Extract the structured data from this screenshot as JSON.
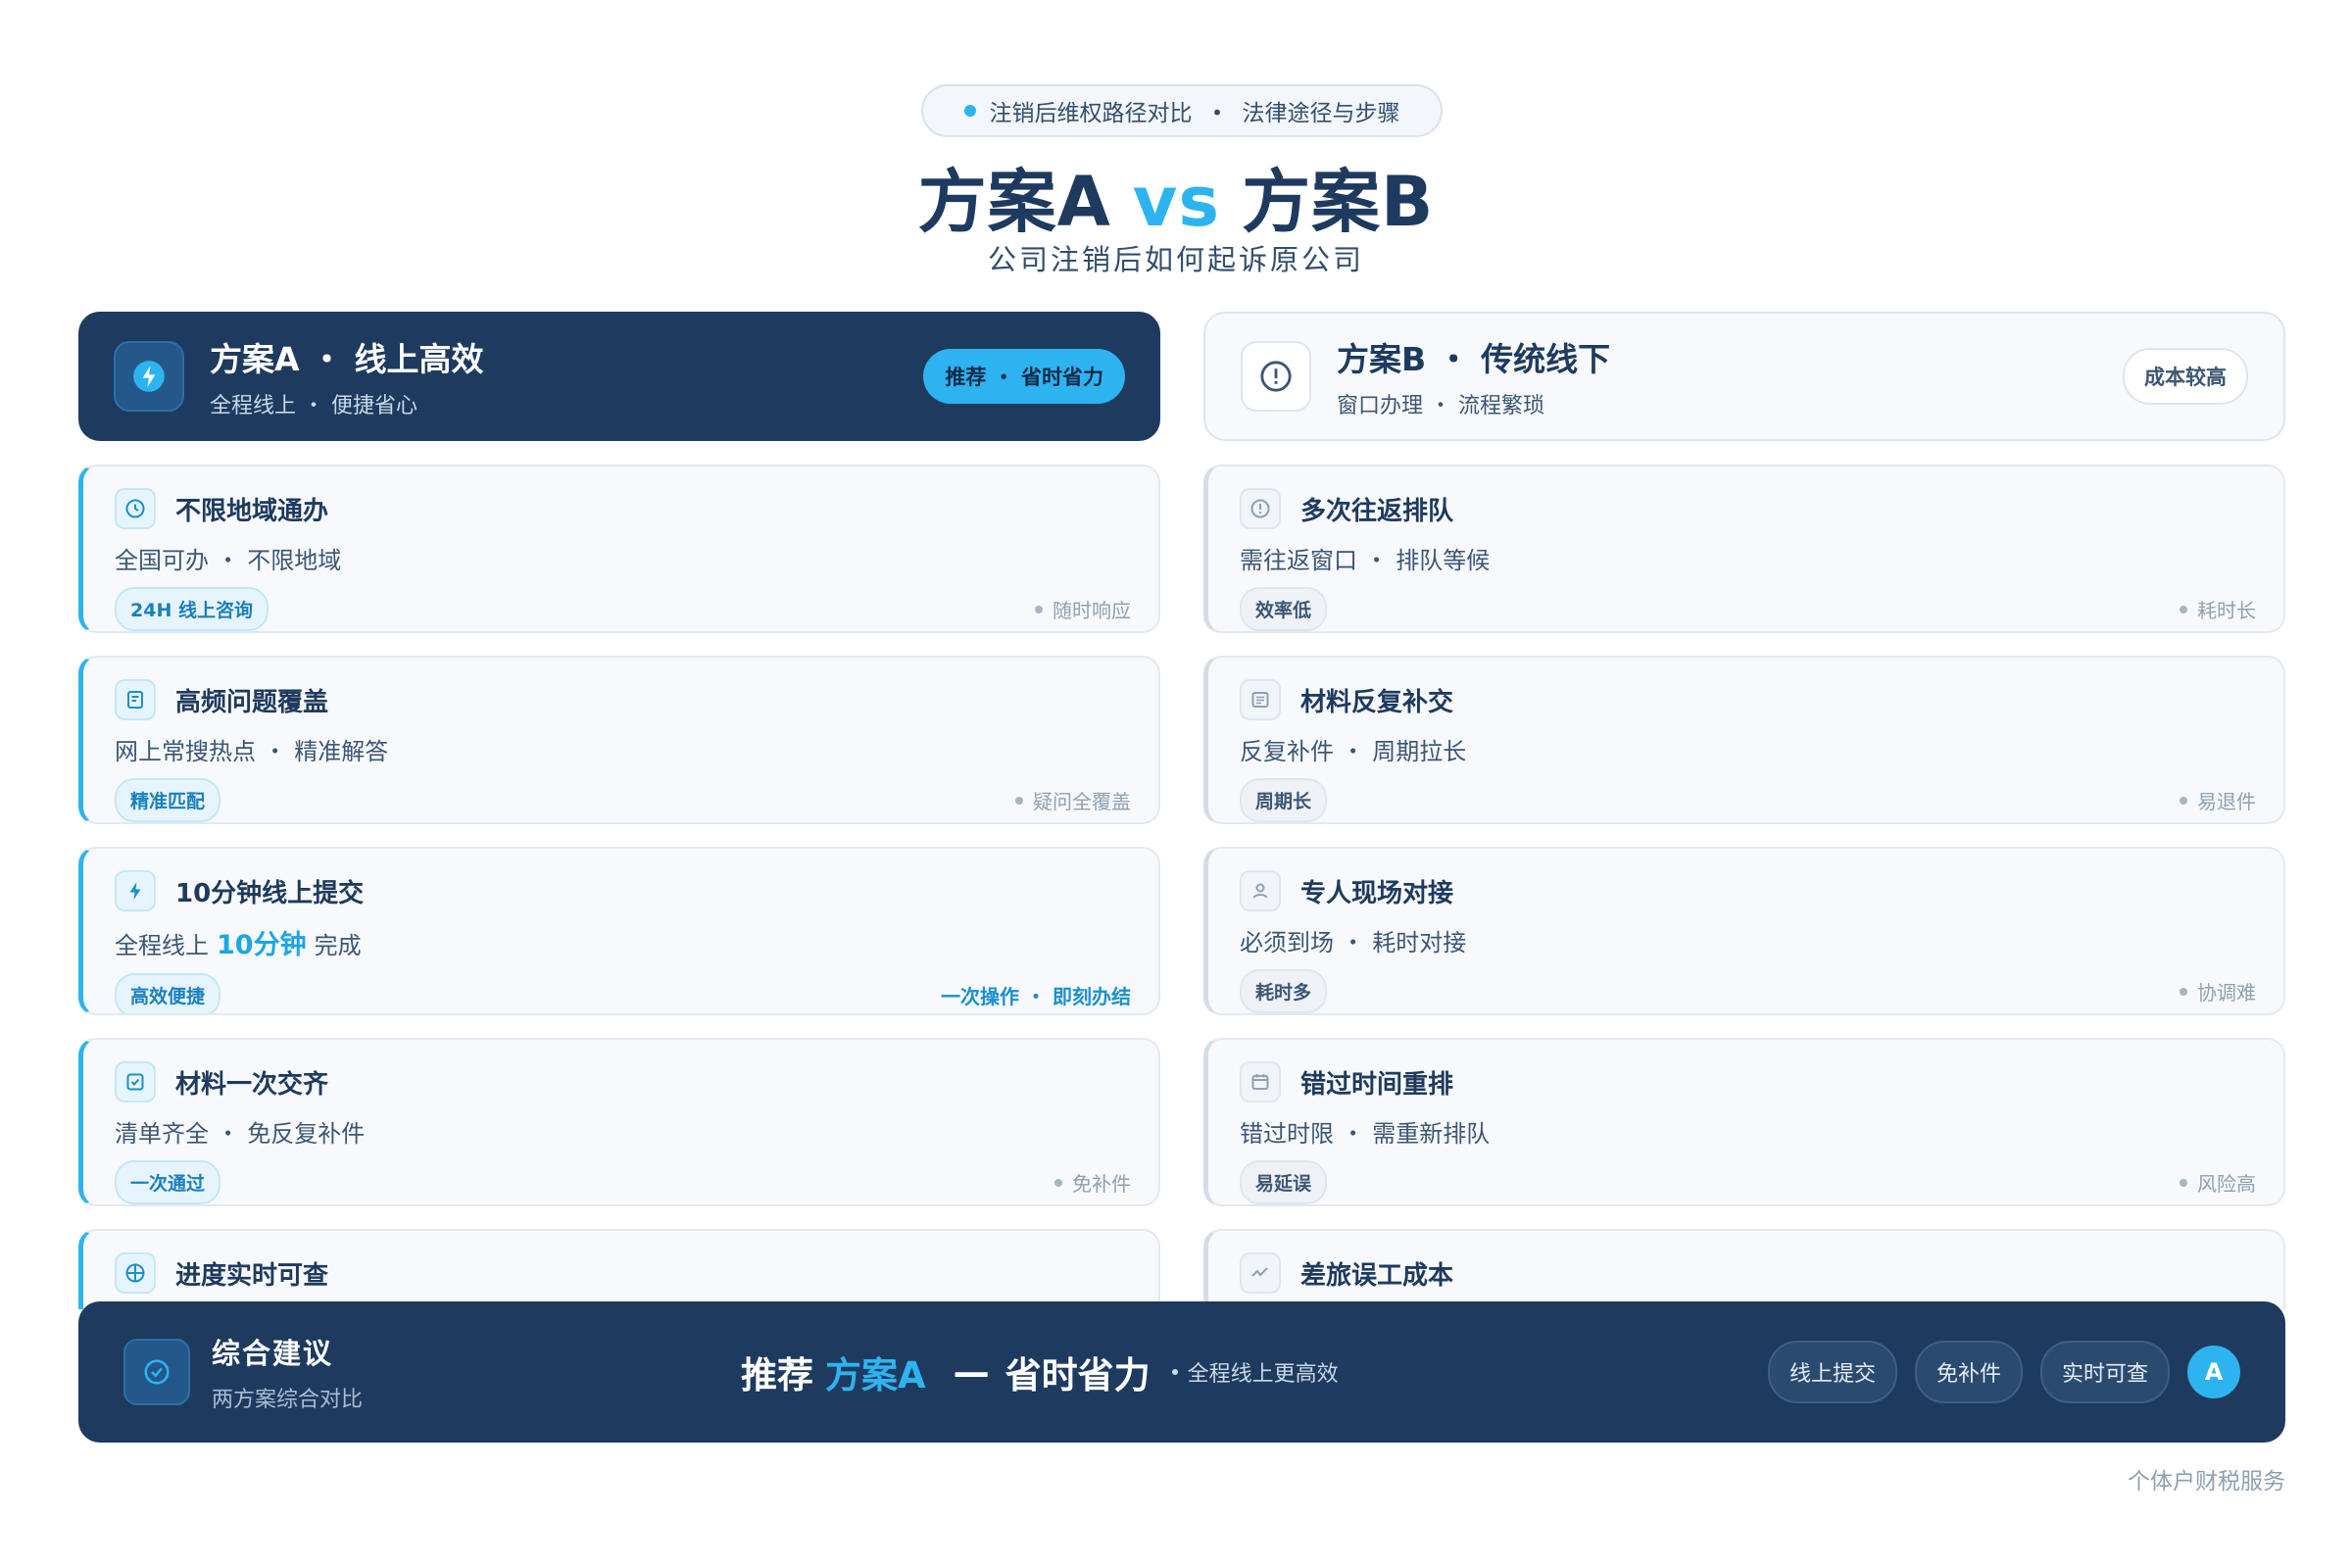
{
  "header": {
    "eyebrow_left": "注销后维权路径对比",
    "eyebrow_right": "法律途径与步骤",
    "title_a": "方案A",
    "title_vs": "vs",
    "title_b": "方案B",
    "subtitle": "公司注销后如何起诉原公司"
  },
  "plan_a": {
    "title": "方案A ・ 线上高效",
    "subtitle": "全程线上 ・ 便捷省心",
    "badge": "推荐 ・ 省时省力",
    "icon": "lightning-icon"
  },
  "plan_b": {
    "title": "方案B ・ 传统线下",
    "subtitle": "窗口办理 ・ 流程繁琐",
    "badge": "成本较高",
    "icon": "alert-icon"
  },
  "cards_a": [
    {
      "title": "不限地域通办",
      "desc": "全国可办 ・ 不限地域",
      "tag": "24H 线上咨询",
      "note": "随时响应",
      "icon": "clock-icon"
    },
    {
      "title": "高频问题覆盖",
      "desc": "网上常搜热点 ・ 精准解答",
      "tag": "精准匹配",
      "note": "疑问全覆盖",
      "icon": "document-icon"
    },
    {
      "title": "10分钟线上提交",
      "desc_pre": "全程线上",
      "desc_hl": "10分钟",
      "desc_post": "完成",
      "tag": "高效便捷",
      "note": "一次操作 ・ 即刻办结",
      "icon": "lightning-icon"
    },
    {
      "title": "材料一次交齐",
      "desc": "清单齐全 ・ 免反复补件",
      "tag": "一次通过",
      "note": "免补件",
      "icon": "checkbox-icon"
    },
    {
      "title": "进度实时可查",
      "desc": "",
      "icon": "globe-icon"
    }
  ],
  "cards_b": [
    {
      "title": "多次往返排队",
      "desc": "需往返窗口 ・ 排队等候",
      "tag": "效率低",
      "note": "耗时长",
      "icon": "alert-icon"
    },
    {
      "title": "材料反复补交",
      "desc": "反复补件 ・ 周期拉长",
      "tag": "周期长",
      "note": "易退件",
      "icon": "list-icon"
    },
    {
      "title": "专人现场对接",
      "desc": "必须到场 ・ 耗时对接",
      "tag": "耗时多",
      "note": "协调难",
      "icon": "user-icon"
    },
    {
      "title": "错过时间重排",
      "desc": "错过时限 ・ 需重新排队",
      "tag": "易延误",
      "note": "风险高",
      "icon": "calendar-icon"
    },
    {
      "title": "差旅误工成本",
      "desc": "",
      "icon": "trend-icon"
    }
  ],
  "summary": {
    "title": "综合建议",
    "subtitle": "两方案综合对比",
    "reco_pre": "推荐",
    "reco_accent": "方案A",
    "reco_dash": "—",
    "reco_post": "省时省力",
    "note": "全程线上更高效",
    "chips": [
      "线上提交",
      "免补件",
      "实时可查"
    ],
    "avatar": "A"
  },
  "footer": "个体户财税服务",
  "colors": {
    "navy": "#1e3a5f",
    "accent": "#2db4f0",
    "card_bg": "#f7f9fc",
    "muted": "#8fa0b4"
  }
}
